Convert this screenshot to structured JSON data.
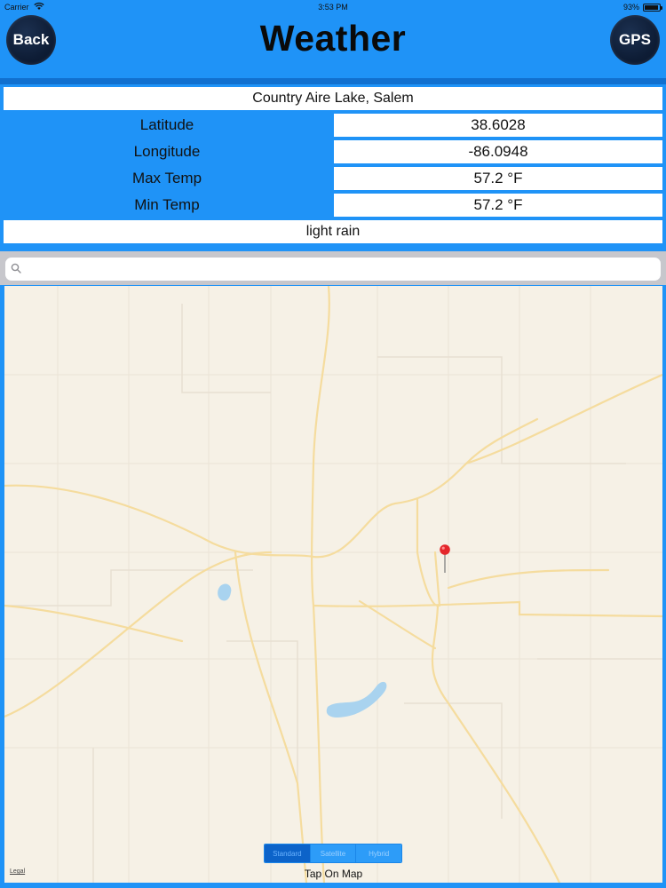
{
  "status_bar": {
    "carrier": "Carrier",
    "time": "3:53 PM",
    "battery": "93%",
    "battery_level": 0.93
  },
  "header": {
    "back_label": "Back",
    "title": "Weather",
    "gps_label": "GPS"
  },
  "location": {
    "name": "Country Aire Lake, Salem"
  },
  "details": [
    {
      "label": "Latitude",
      "value": "38.6028"
    },
    {
      "label": "Longitude",
      "value": "-86.0948"
    },
    {
      "label": "Max Temp",
      "value": "57.2 °F"
    },
    {
      "label": "Min Temp",
      "value": "57.2 °F"
    }
  ],
  "conditions": "light rain",
  "search": {
    "placeholder": ""
  },
  "map": {
    "modes": [
      "Standard",
      "Satellite",
      "Hybrid"
    ],
    "active_mode": "Standard",
    "legal": "Legal",
    "tap_hint": "Tap On Map"
  },
  "colors": {
    "background": "#1f93f7",
    "button": "#0e1d36",
    "map_bg": "#f6f1e6",
    "road": "#f5dc9e",
    "water": "#a9d3ef",
    "pin": "#e4262b"
  },
  "icons": {
    "search": "search-icon",
    "pin": "map-pin-icon"
  }
}
